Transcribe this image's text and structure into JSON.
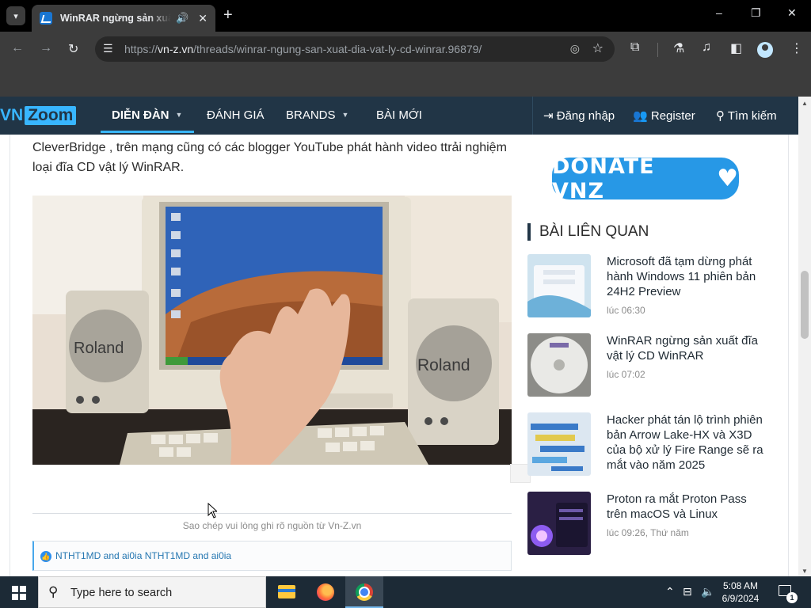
{
  "browser": {
    "tab_title": "WinRAR ngừng sản xuất đĩa vật lý CD WinRAR",
    "tab_audio_icon": "speaker-icon",
    "tab_close_glyph": "✕",
    "new_tab_glyph": "+",
    "url_scheme": "https://",
    "url_host": "vn-z.vn",
    "url_path": "/threads/winrar-ngung-san-xuat-dia-vat-ly-cd-winrar.96879/",
    "window_controls": [
      "–",
      "❐",
      "✕"
    ]
  },
  "site": {
    "logo_vn": "VN",
    "logo_zoom": "Zoom",
    "nav": {
      "forum": "DIỄN ĐÀN",
      "review": "ĐÁNH GIÁ",
      "brands": "BRANDS",
      "new_posts": "BÀI MỚI",
      "login": "Đăng nhập",
      "register": "Register",
      "search": "Tìm kiếm"
    },
    "accent_color": "#38b6ff",
    "nav_bg_color": "#213546"
  },
  "article": {
    "paragraph": "CleverBridge , trên mạng cũng có các blogger YouTube phát hành video ttrải nghiệm loại đĩa CD vật lý WinRAR.",
    "copy_note": "Sao chép vui lòng ghi rõ nguồn từ Vn-Z.vn",
    "reactions": "NTHT1MD and ai0ia NTHT1MD and ai0ia"
  },
  "sidebar": {
    "donate_label": "DONATE VNZ",
    "related_heading": "BÀI LIÊN QUAN",
    "related": [
      {
        "title": "Microsoft đã tạm dừng phát hành Windows 11 phiên bản 24H2 Preview",
        "time": "lúc 06:30"
      },
      {
        "title": "WinRAR ngừng sản xuất đĩa vật lý CD WinRAR",
        "time": "lúc 07:02"
      },
      {
        "title": "Hacker phát tán lộ trình phiên bản Arrow Lake-HX và X3D của bộ xử lý Fire Range sẽ ra mắt vào năm 2025",
        "time": ""
      },
      {
        "title": "Proton ra mắt Proton Pass trên macOS và Linux",
        "time": "lúc 09:26, Thứ năm"
      }
    ]
  },
  "taskbar": {
    "search_placeholder": "Type here to search",
    "time": "5:08 AM",
    "date": "6/9/2024",
    "notification_count": "1"
  },
  "photo_text": {
    "speaker_brand": "Roland"
  }
}
